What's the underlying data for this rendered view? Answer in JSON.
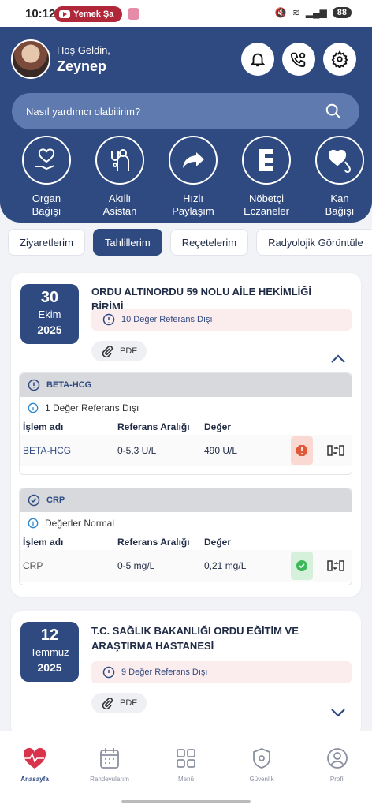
{
  "status_bar": {
    "time": "10:12",
    "media_app": "Yemek Şa",
    "battery": "88"
  },
  "header": {
    "greeting": "Hoş Geldin,",
    "user_name": "Zeynep",
    "search_placeholder": "Nasıl yardımcı olabilirim?",
    "quick_actions": [
      {
        "label_line1": "Organ",
        "label_line2": "Bağışı",
        "icon": "heart-hand-icon"
      },
      {
        "label_line1": "Akıllı",
        "label_line2": "Asistan",
        "icon": "doctor-icon"
      },
      {
        "label_line1": "Hızlı",
        "label_line2": "Paylaşım",
        "icon": "share-arrow-icon"
      },
      {
        "label_line1": "Nöbetçi",
        "label_line2": "Eczaneler",
        "icon": "pharmacy-e-icon"
      },
      {
        "label_line1": "Kan",
        "label_line2": "Bağışı",
        "icon": "blood-drop-icon"
      }
    ]
  },
  "tabs": [
    "Ziyaretlerim",
    "Tahlillerim",
    "Reçetelerim",
    "Radyolojik Görüntüle"
  ],
  "active_tab": "Tahlillerim",
  "visits": [
    {
      "day": "30",
      "month": "Ekim",
      "year": "2025",
      "hospital": "ORDU ALTINORDU 59 NOLU AİLE HEKİMLİĞİ BİRİMİ",
      "ref_summary": "10 Değer Referans Dışı",
      "pdf_label": "PDF",
      "tests": [
        {
          "name": "BETA-HCG",
          "note": "1 Değer Referans Dışı",
          "col_headers": [
            "İşlem adı",
            "Referans Aralığı",
            "Değer"
          ],
          "row": {
            "name": "BETA-HCG",
            "range": "0-5,3 U/L",
            "value": "490 U/L",
            "status": "abnormal"
          }
        },
        {
          "name": "CRP",
          "note": "Değerler Normal",
          "col_headers": [
            "İşlem adı",
            "Referans Aralığı",
            "Değer"
          ],
          "row": {
            "name": "CRP",
            "range": "0-5 mg/L",
            "value": "0,21 mg/L",
            "status": "normal"
          }
        }
      ]
    },
    {
      "day": "12",
      "month": "Temmuz",
      "year": "2025",
      "hospital": "T.C. SAĞLIK BAKANLIĞI ORDU EĞİTİM VE ARAŞTIRMA HASTANESİ",
      "ref_summary": "9 Değer Referans Dışı",
      "pdf_label": "PDF"
    }
  ],
  "bottom_nav": [
    "Anasayfa",
    "Randevularım",
    "Menü",
    "Güvenlik",
    "Profil"
  ],
  "colors": {
    "primary": "#2f4a80",
    "alert": "#e05a3a",
    "ok": "#3bb85a"
  }
}
